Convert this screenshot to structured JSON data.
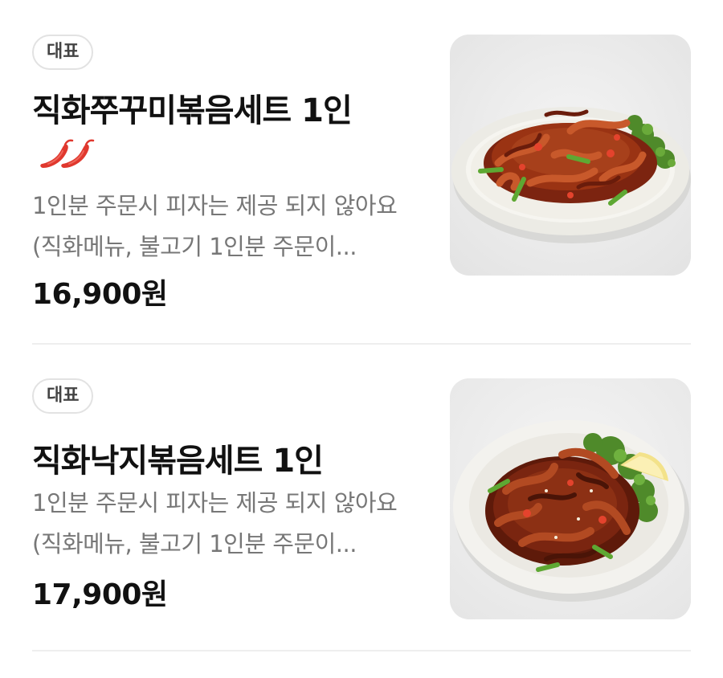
{
  "menu": [
    {
      "badge": "대표",
      "title": "직화쭈꾸미볶음세트 1인",
      "spicy_icon": "chili-pepper-icon",
      "description": "1인분 주문시 피자는 제공 되지 않아요 (직화메뉴, 불고기 1인분 주문이...",
      "price": "16,900원",
      "image": "spicy-webfoot-octopus-stir-fry-plate"
    },
    {
      "badge": "대표",
      "title": "직화낙지볶음세트 1인",
      "description": "1인분 주문시 피자는 제공 되지 않아요 (직화메뉴, 불고기 1인분 주문이...",
      "price": "17,900원",
      "image": "spicy-small-octopus-stir-fry-bowl"
    }
  ],
  "colors": {
    "title": "#111111",
    "description": "#777777",
    "badge_border": "#e2e2e2",
    "divider": "#eeeeee",
    "chili": "#e0382e"
  }
}
